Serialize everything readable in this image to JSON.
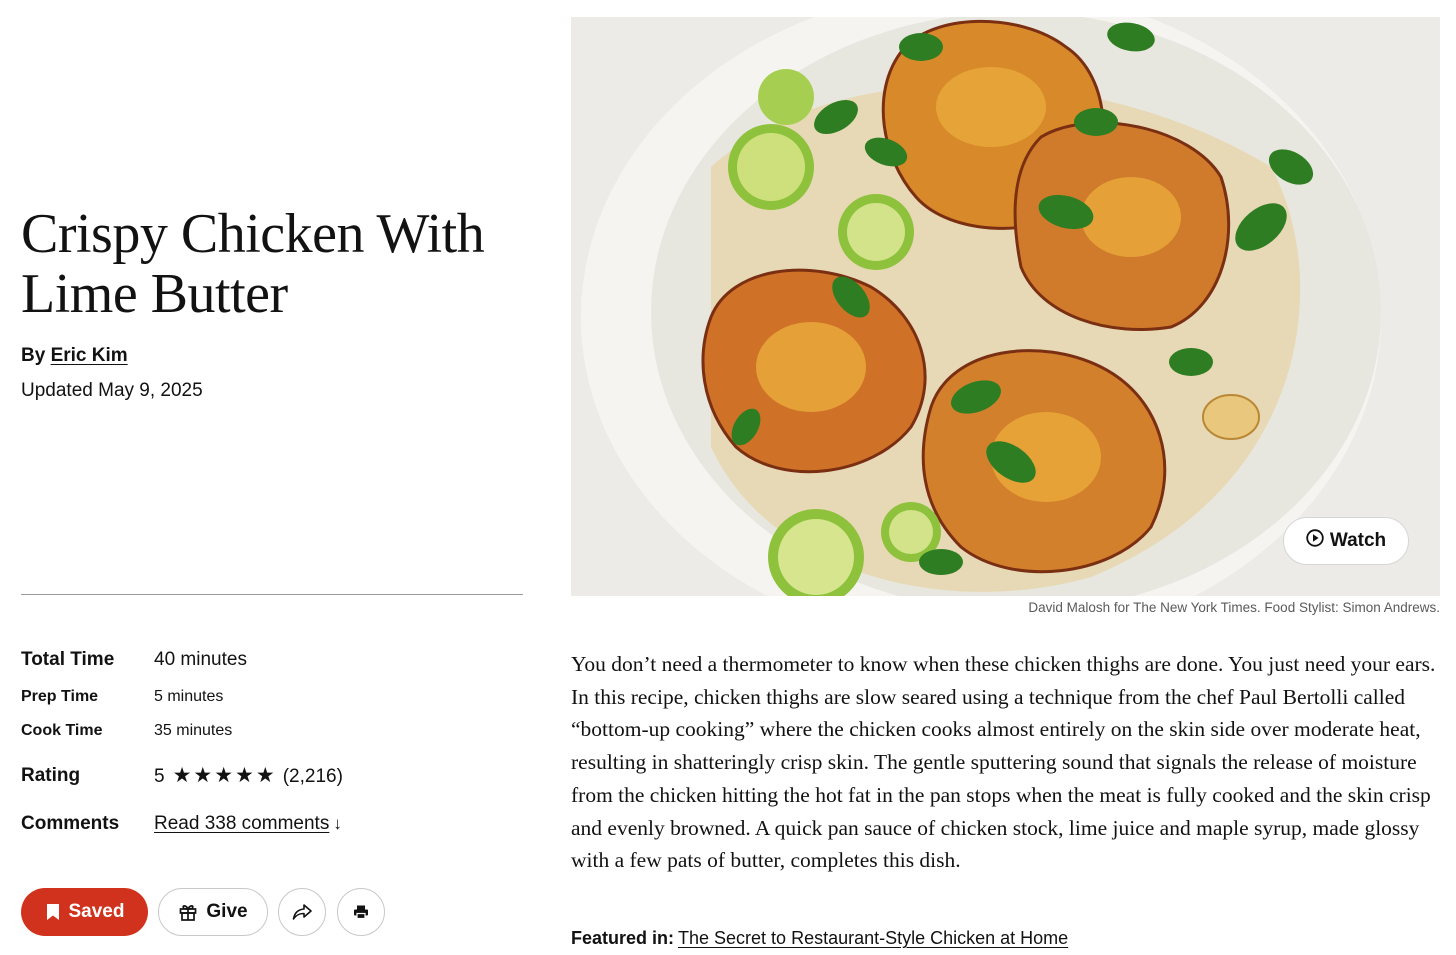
{
  "recipe": {
    "title": "Crispy Chicken With Lime Butter",
    "byline_prefix": "By",
    "author": "Eric Kim",
    "updated": "Updated May 9, 2025"
  },
  "meta": {
    "total_time": {
      "label": "Total Time",
      "value": "40 minutes"
    },
    "prep_time": {
      "label": "Prep Time",
      "value": "5 minutes"
    },
    "cook_time": {
      "label": "Cook Time",
      "value": "35 minutes"
    },
    "rating": {
      "label": "Rating",
      "score": "5",
      "stars": 5,
      "max_stars": 5,
      "count": "(2,216)"
    },
    "comments": {
      "label": "Comments",
      "link_text": "Read 338 comments"
    }
  },
  "actions": {
    "saved_label": "Saved",
    "give_label": "Give",
    "share_icon": "share-icon",
    "print_icon": "print-icon",
    "saved_color": "#d0321d"
  },
  "photo": {
    "watch_label": "Watch",
    "credit": "David Malosh for The New York Times. Food Stylist: Simon Andrews."
  },
  "intro": "You don’t need a thermometer to know when these chicken thighs are done. You just need your ears. In this recipe, chicken thighs are slow seared using a technique from the chef Paul Bertolli called “bottom-up cooking” where the chicken cooks almost entirely on the skin side over moderate heat, resulting in shatteringly crisp skin. The gentle sputtering sound that signals the release of moisture from the chicken hitting the hot fat in the pan stops when the meat is fully cooked and the skin crisp and evenly browned. A quick pan sauce of chicken stock, lime juice and maple syrup, made glossy with a few pats of butter, completes this dish.",
  "featured": {
    "label": "Featured in:",
    "link_text": "The Secret to Restaurant-Style Chicken at Home"
  }
}
